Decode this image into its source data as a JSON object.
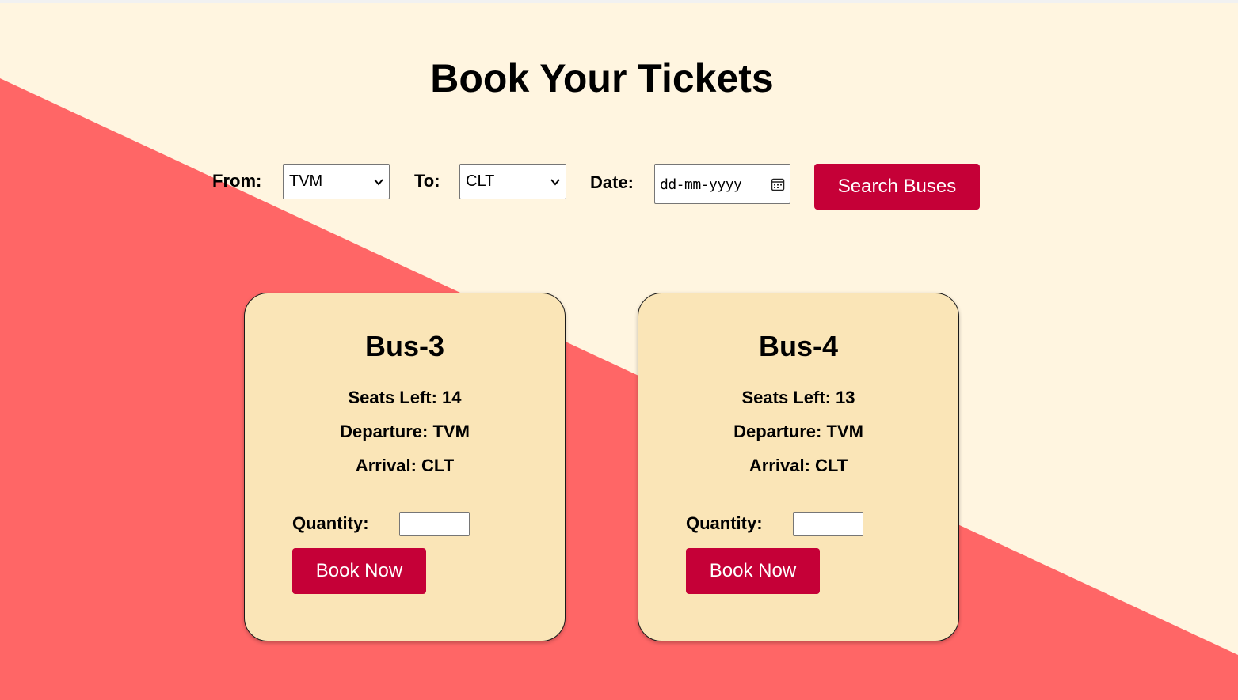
{
  "page": {
    "title": "Book Your Tickets",
    "colors": {
      "background": "#fff5e0",
      "diagonal": "#ff6666",
      "button": "#c50037",
      "card": "#fae5b7"
    }
  },
  "search": {
    "from_label": "From:",
    "from_value": "TVM",
    "to_label": "To:",
    "to_value": "CLT",
    "date_label": "Date:",
    "date_placeholder": "dd-mm-yyyy",
    "button_label": "Search Buses"
  },
  "buses": [
    {
      "name": "Bus-3",
      "seats": "Seats Left: 14",
      "departure": "Departure: TVM",
      "arrival": "Arrival: CLT",
      "quantity_label": "Quantity:",
      "quantity_value": "",
      "book_label": "Book Now"
    },
    {
      "name": "Bus-4",
      "seats": "Seats Left: 13",
      "departure": "Departure: TVM",
      "arrival": "Arrival: CLT",
      "quantity_label": "Quantity:",
      "quantity_value": "",
      "book_label": "Book Now"
    }
  ]
}
